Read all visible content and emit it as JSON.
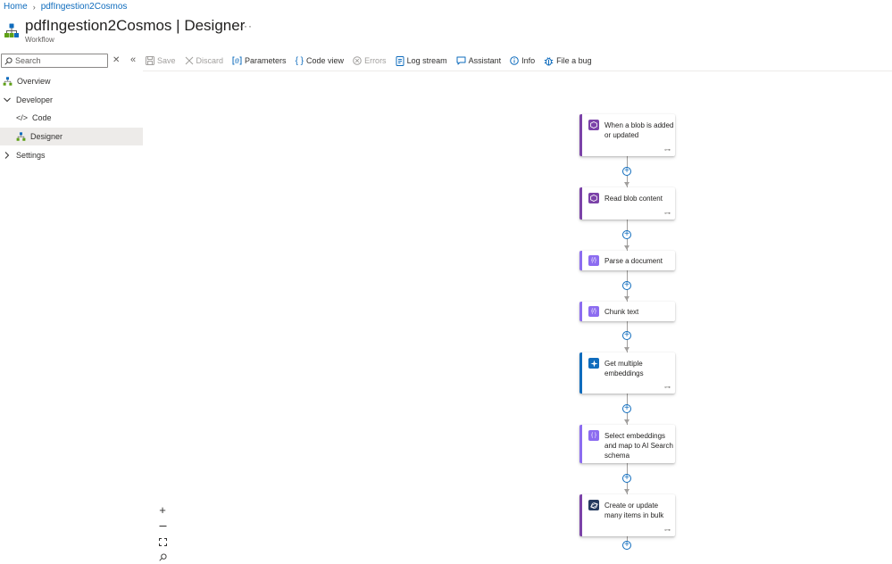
{
  "breadcrumb": {
    "home": "Home",
    "current": "pdfIngestion2Cosmos"
  },
  "header": {
    "title": "pdfIngestion2Cosmos",
    "separator": "|",
    "view": "Designer",
    "subtitle": "Workflow",
    "more": "···"
  },
  "search": {
    "placeholder": "Search",
    "value": ""
  },
  "toolbar": {
    "save": "Save",
    "discard": "Discard",
    "parameters": "Parameters",
    "code_view": "Code view",
    "errors": "Errors",
    "log_stream": "Log stream",
    "assistant": "Assistant",
    "info": "Info",
    "file_bug": "File a bug"
  },
  "sidebar": {
    "items": [
      {
        "label": "Overview",
        "icon": "workflow-icon"
      },
      {
        "label": "Developer",
        "icon": "chevron-down-icon",
        "expanded": true
      },
      {
        "label": "Code",
        "icon": "code-icon"
      },
      {
        "label": "Designer",
        "icon": "workflow-icon",
        "selected": true
      },
      {
        "label": "Settings",
        "icon": "chevron-right-icon",
        "expanded": false
      }
    ]
  },
  "workflow": {
    "steps": [
      {
        "label": "When a blob is added or updated",
        "icon": "blob-trigger-icon",
        "color": "#7b42a8"
      },
      {
        "label": "Read blob content",
        "icon": "blob-icon",
        "color": "#7b42a8"
      },
      {
        "label": "Parse a document",
        "icon": "data-operation-icon",
        "color": "#8c6cf0"
      },
      {
        "label": "Chunk text",
        "icon": "data-operation-icon",
        "color": "#8c6cf0"
      },
      {
        "label": "Get multiple embeddings",
        "icon": "openai-icon",
        "color": "#0f6cbd"
      },
      {
        "label": "Select embeddings and map to AI Search schema",
        "icon": "select-icon",
        "color": "#8c6cf0"
      },
      {
        "label": "Create or update many items in bulk",
        "icon": "cosmos-icon",
        "color": "#243a5e"
      }
    ]
  },
  "colors": {
    "link": "#0f6cbd",
    "accent": "#7b42a8",
    "plus": "#0f6cbd"
  }
}
